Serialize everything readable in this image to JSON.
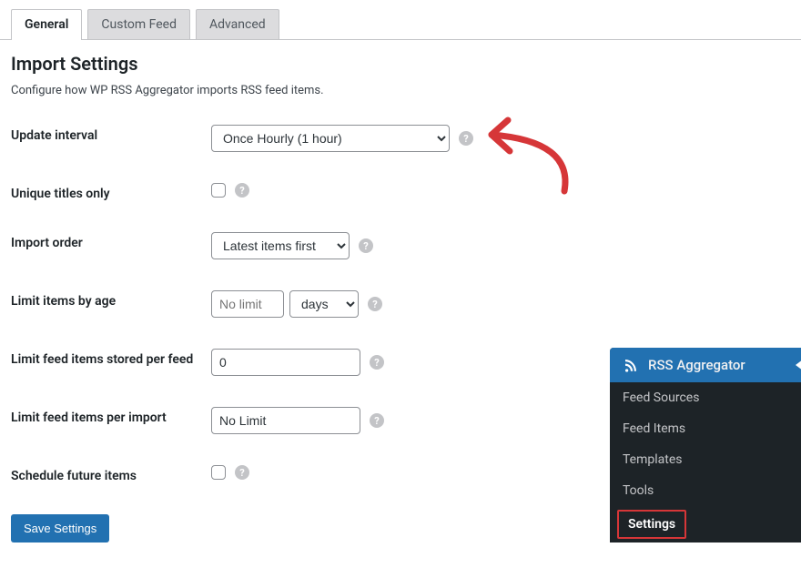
{
  "tabs": [
    {
      "label": "General",
      "active": true
    },
    {
      "label": "Custom Feed",
      "active": false
    },
    {
      "label": "Advanced",
      "active": false
    }
  ],
  "section": {
    "title": "Import Settings",
    "description": "Configure how WP RSS Aggregator imports RSS feed items."
  },
  "fields": {
    "update_interval": {
      "label": "Update interval",
      "value": "Once Hourly (1 hour)"
    },
    "unique_titles": {
      "label": "Unique titles only",
      "checked": false
    },
    "import_order": {
      "label": "Import order",
      "value": "Latest items first"
    },
    "limit_by_age": {
      "label": "Limit items by age",
      "value": "No limit",
      "unit": "days"
    },
    "limit_stored": {
      "label": "Limit feed items stored per feed",
      "value": "0"
    },
    "limit_per_import": {
      "label": "Limit feed items per import",
      "value": "No Limit"
    },
    "schedule_future": {
      "label": "Schedule future items",
      "checked": false
    }
  },
  "save_button": "Save Settings",
  "sidebar": {
    "title": "RSS Aggregator",
    "items": [
      "Feed Sources",
      "Feed Items",
      "Templates",
      "Tools",
      "Settings"
    ],
    "highlighted_index": 4
  }
}
